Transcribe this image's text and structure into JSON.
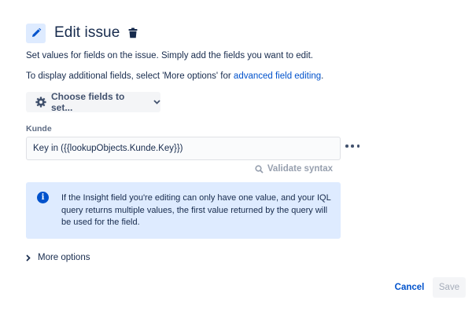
{
  "header": {
    "title": "Edit issue",
    "icon": "pencil-icon",
    "delete_icon": "trash-icon"
  },
  "description": {
    "line1": "Set values for fields on the issue. Simply add the fields you want to edit.",
    "line2_prefix": "To display additional fields, select 'More options' for ",
    "line2_link": "advanced field editing",
    "line2_suffix": "."
  },
  "choose_fields": {
    "label": "Choose fields to set...",
    "icon": "gear-icon",
    "chevron": "chevron-down-icon"
  },
  "field": {
    "label": "Kunde",
    "value": "Key in ({{lookupObjects.Kunde.Key}})",
    "more_icon": "more-horizontal-icon"
  },
  "validate": {
    "label": "Validate syntax",
    "icon": "search-icon"
  },
  "info": {
    "icon": "info-icon",
    "glyph": "i",
    "text": "If the Insight field you're editing can only have one value, and your IQL query returns multiple values, the first value returned by the query will be used for the field."
  },
  "more_options": {
    "label": "More options",
    "icon": "chevron-right-icon"
  },
  "actions": {
    "cancel": "Cancel",
    "save": "Save"
  },
  "colors": {
    "accent": "#0052cc",
    "info_bg": "#deebff",
    "text": "#172b4d",
    "muted": "#97a0af"
  }
}
